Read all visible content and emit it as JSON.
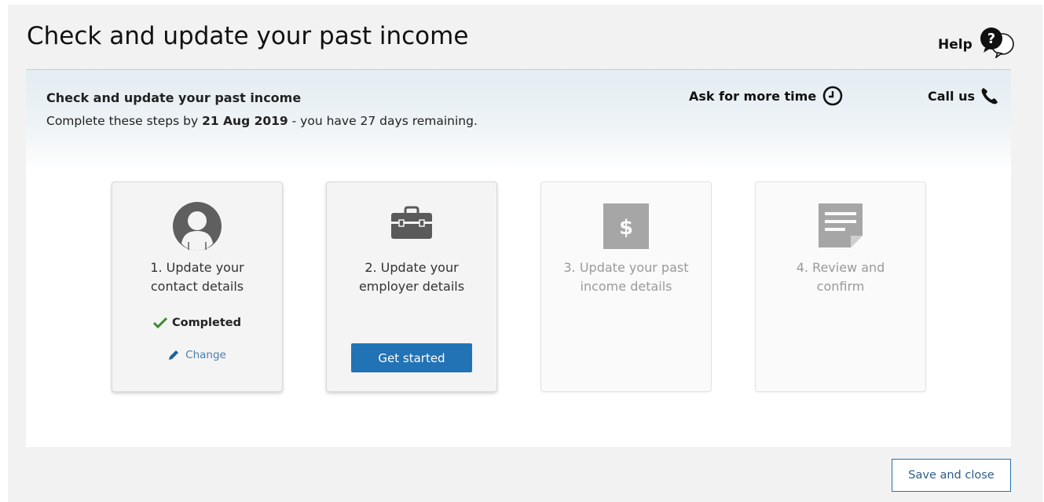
{
  "page": {
    "title": "Check and update your past income",
    "help_label": "Help"
  },
  "panel": {
    "title": "Check and update your past income",
    "subtitle_prefix": "Complete these steps by ",
    "due_date": "21 Aug 2019",
    "subtitle_suffix": " - you have 27 days remaining.",
    "ask_more_time": "Ask for more time",
    "call_us": "Call us"
  },
  "steps": [
    {
      "line1": "1. Update your",
      "line2": "contact details",
      "icon": "person-icon",
      "status": "Completed",
      "change_label": "Change"
    },
    {
      "line1": "2. Update your",
      "line2": "employer details",
      "icon": "briefcase-icon",
      "button_label": "Get started"
    },
    {
      "line1": "3. Update your past",
      "line2": "income details",
      "icon": "dollar-icon",
      "state": "disabled"
    },
    {
      "line1": "4. Review and",
      "line2": "confirm",
      "icon": "document-icon",
      "state": "disabled"
    }
  ],
  "footer": {
    "save_close_label": "Save and close"
  },
  "colors": {
    "accent": "#2273b5",
    "completed_check": "#3d8b2f",
    "link": "#4a7fb0"
  }
}
